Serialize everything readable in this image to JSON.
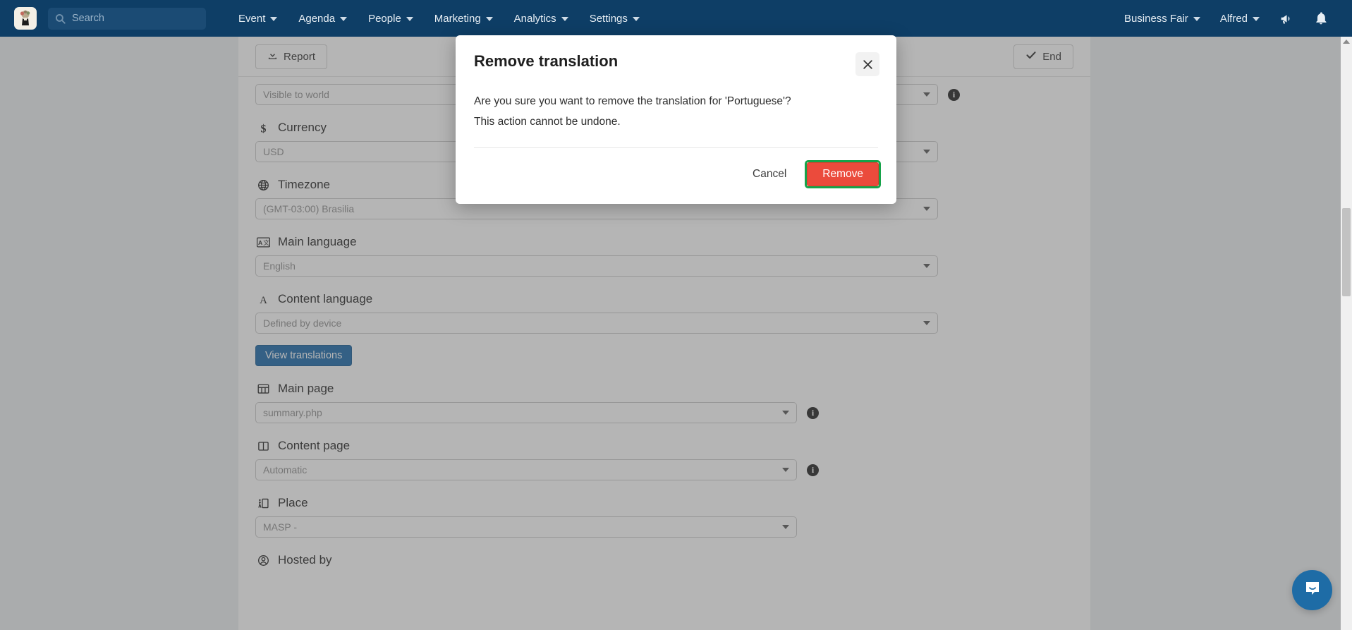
{
  "navbar": {
    "logo_name": "event-logo",
    "search": {
      "placeholder": "Search",
      "icon": "search-icon"
    },
    "menu": [
      {
        "label": "Event"
      },
      {
        "label": "Agenda"
      },
      {
        "label": "People"
      },
      {
        "label": "Marketing"
      },
      {
        "label": "Analytics"
      },
      {
        "label": "Settings"
      }
    ],
    "right": {
      "event_selector": "Business Fair",
      "user": "Alfred",
      "announcement_icon": "megaphone-icon",
      "notification_icon": "bell-icon"
    }
  },
  "toolbar": {
    "report_label": "Report",
    "report_icon": "download-icon",
    "end_label": "End",
    "end_icon": "check-icon"
  },
  "form": {
    "fields": [
      {
        "key": "visibility",
        "label": "",
        "icon": "",
        "value": "Visible to world",
        "has_info": true,
        "show_label": false
      },
      {
        "key": "currency",
        "label": "Currency",
        "icon": "dollar-icon",
        "value": "USD",
        "has_info": false,
        "show_label": true
      },
      {
        "key": "timezone",
        "label": "Timezone",
        "icon": "globe-icon",
        "value": "(GMT-03:00) Brasilia",
        "has_info": false,
        "show_label": true
      },
      {
        "key": "main_language",
        "label": "Main language",
        "icon": "translate-icon",
        "value": "English",
        "has_info": false,
        "show_label": true
      },
      {
        "key": "content_language",
        "label": "Content language",
        "icon": "letter-a-icon",
        "value": "Defined by device",
        "has_info": false,
        "show_label": true
      },
      {
        "key": "main_page",
        "label": "Main page",
        "icon": "grid-icon",
        "value": "summary.php",
        "has_info": true,
        "show_label": true
      },
      {
        "key": "content_page",
        "label": "Content page",
        "icon": "columns-icon",
        "value": "Automatic",
        "has_info": true,
        "show_label": true
      },
      {
        "key": "place",
        "label": "Place",
        "icon": "venue-icon",
        "value": "MASP -",
        "has_info": false,
        "show_label": true
      },
      {
        "key": "hosted_by",
        "label": "Hosted by",
        "icon": "person-circle-icon",
        "value": "",
        "has_info": false,
        "show_label": true
      }
    ],
    "view_translations_label": "View translations"
  },
  "modal": {
    "title": "Remove translation",
    "close_icon": "close-icon",
    "line1": "Are you sure you want to remove the translation for 'Portuguese'?",
    "line2": "This action cannot be undone.",
    "cancel_label": "Cancel",
    "remove_label": "Remove"
  },
  "chat": {
    "icon": "chat-bubble-icon"
  },
  "colors": {
    "navbar_bg": "#0e3e66",
    "primary_button": "#1565a8",
    "danger_button": "#eb4b3c",
    "highlight_border": "#16a34a",
    "chat_bg": "#1e6ca6"
  }
}
